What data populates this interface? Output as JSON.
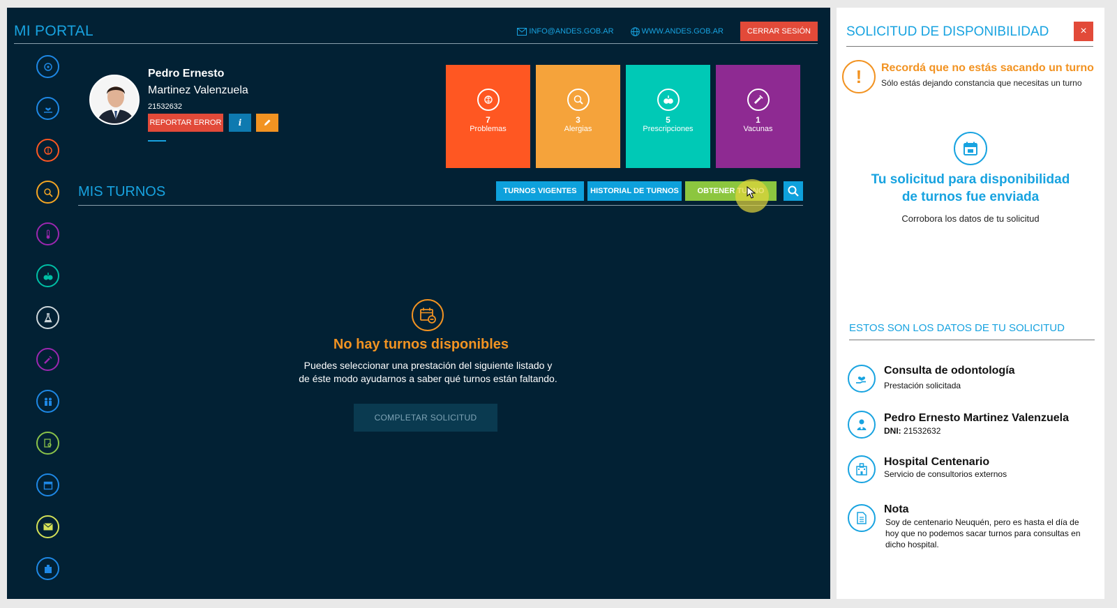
{
  "header": {
    "title": "MI PORTAL",
    "email_link": "INFO@ANDES.GOB.AR",
    "web_link": "WWW.ANDES.GOB.AR",
    "logout_label": "CERRAR SESIÓN"
  },
  "sidebar": {
    "items": [
      {
        "icon": "dashboard-icon",
        "color": "#1e88e5"
      },
      {
        "icon": "heart-hand-icon",
        "color": "#1e88e5"
      },
      {
        "icon": "brain-icon",
        "color": "#ff5722"
      },
      {
        "icon": "allergy-search-icon",
        "color": "#f5a623"
      },
      {
        "icon": "thermometer-icon",
        "color": "#9c27b0"
      },
      {
        "icon": "pills-icon",
        "color": "#00bfa5"
      },
      {
        "icon": "flask-icon",
        "color": "#cfd8dc"
      },
      {
        "icon": "syringe-icon",
        "color": "#9c27b0"
      },
      {
        "icon": "family-icon",
        "color": "#1e88e5"
      },
      {
        "icon": "document-search-icon",
        "color": "#8bc34a"
      },
      {
        "icon": "calendar-icon",
        "color": "#1e88e5"
      },
      {
        "icon": "mail-icon",
        "color": "#d4e157"
      },
      {
        "icon": "hospital-icon",
        "color": "#1e88e5"
      }
    ]
  },
  "profile": {
    "first_name": "Pedro Ernesto",
    "last_name": "Martinez Valenzuela",
    "dni": "21532632",
    "report_label": "REPORTAR ERROR",
    "info_label": "i"
  },
  "stats": [
    {
      "count": "7",
      "label": "Problemas",
      "color": "#ff5722",
      "icon": "brain-icon"
    },
    {
      "count": "3",
      "label": "Alergias",
      "color": "#f5a33b",
      "icon": "allergy-search-icon"
    },
    {
      "count": "5",
      "label": "Prescripciones",
      "color": "#00c9b6",
      "icon": "pills-icon"
    },
    {
      "count": "1",
      "label": "Vacunas",
      "color": "#8e2a92",
      "icon": "syringe-icon"
    }
  ],
  "turnos": {
    "title": "MIS TURNOS",
    "tab_vigentes": "TURNOS VIGENTES",
    "tab_historial": "HISTORIAL DE TURNOS",
    "tab_obtener": "OBTENER TURNO",
    "empty_title": "No hay turnos disponibles",
    "empty_line1": "Puedes seleccionar una prestación del siguiente listado y",
    "empty_line2": "de éste modo ayudarnos a saber qué turnos están faltando.",
    "complete_label": "COMPLETAR SOLICITUD"
  },
  "panel": {
    "title": "SOLICITUD DE DISPONIBILIDAD",
    "close_label": "×",
    "warning_title": "Recordá que no estás sacando un turno",
    "warning_sub": "Sólo estás dejando constancia que necesitas un turno",
    "sent_line1": "Tu solicitud para disponibilidad",
    "sent_line2": "de turnos fue enviada",
    "sent_sub": "Corrobora los datos de tu solicitud",
    "section_title": "ESTOS SON LOS DATOS DE TU SOLICITUD",
    "service_title": "Consulta de odontología",
    "service_sub": "Prestación solicitada",
    "patient_name": "Pedro Ernesto Martinez Valenzuela",
    "patient_dni_label": "DNI:",
    "patient_dni": "21532632",
    "hospital_title": "Hospital Centenario",
    "hospital_sub": "Servicio de consultorios externos",
    "note_title": "Nota",
    "note_text": "Soy de centenario Neuquén, pero es hasta el día de hoy que no podemos sacar turnos para consultas en dicho hospital."
  }
}
